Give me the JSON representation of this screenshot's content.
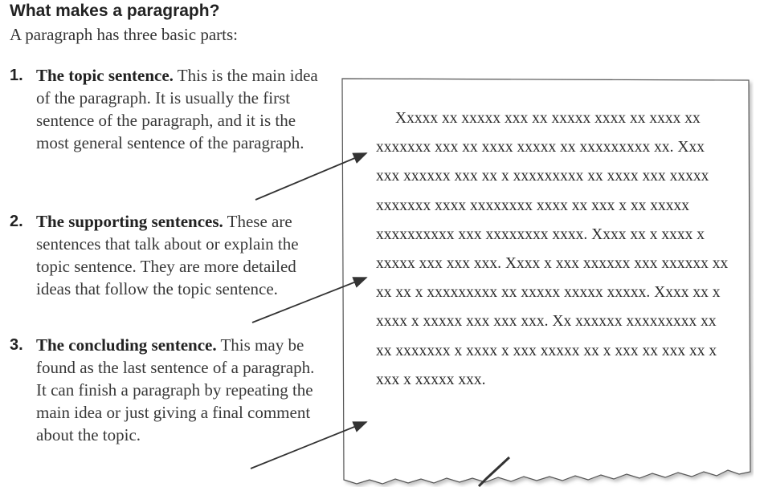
{
  "heading": "What makes a paragraph?",
  "intro": "A paragraph has three basic parts:",
  "items": [
    {
      "number": "1.",
      "lead": "The topic sentence.",
      "text": " This is the main idea of the paragraph. It is usually the first sentence of the paragraph, and it is the most general sentence of the paragraph."
    },
    {
      "number": "2.",
      "lead": "The supporting sentences.",
      "text": " These are sentences that talk about or explain the topic sentence. They are more detailed ideas that follow the topic sentence."
    },
    {
      "number": "3.",
      "lead": "The concluding sentence.",
      "text": " This may be found as the last sentence of a paragraph. It can finish a paragraph by repeating the main idea or just giving a final comment about the topic."
    }
  ],
  "sample_paragraph": "Xxxxx xx xxxxx xxx xx xxxxx xxxx xx xxxx xx xxxxxxx xxx xx xxxx xxxxx xx xxxxxxxxx xx. Xxx xxx xxxxxx xxx xx x xxxxxxxxx xx xxxx xxx xxxxx xxxxxxx xxxx xxxxxxxx xxxx xx xxx x xx xxxxx xxxxxxxxxx xxx xxxxxxxx xxxx. Xxxx xx x xxxx x xxxxx xxx xxx xxx. Xxxx x xxx xxxxxx xxx xxxxxx xx xx xx x xxxxxxxxx xx xxxxx xxxxx xxxxx. Xxxx xx x xxxx x xxxxx xxx xxx xxx. Xx xxxxxx xxxxxxxxx xx xx xxxxxxx x xxxx x xxx xxxxx xx x xxx xx xxx xx x xxx x xxxxx xxx."
}
